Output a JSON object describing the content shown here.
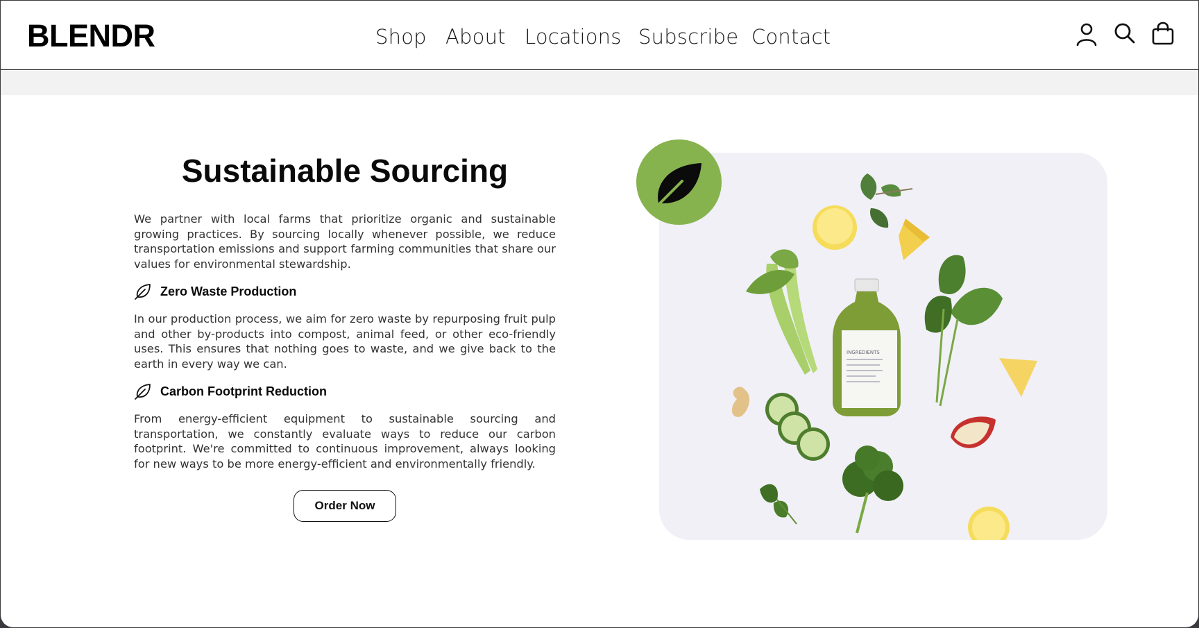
{
  "header": {
    "logo": "BLENDR",
    "nav": [
      {
        "label": "Shop"
      },
      {
        "label": "About"
      },
      {
        "label": "Locations"
      },
      {
        "label": "Subscribe"
      },
      {
        "label": "Contact"
      }
    ],
    "icons": [
      "user-icon",
      "search-icon",
      "shopping-bag-icon"
    ]
  },
  "main": {
    "title": "Sustainable Sourcing",
    "intro": "We partner with local farms that prioritize organic and sustainable growing practices. By sourcing locally whenever possible, we reduce transportation emissions and support farming communities that share our values for environmental stewardship.",
    "features": [
      {
        "icon": "leaf-icon",
        "title": "Zero Waste Production",
        "text": "In our production process, we aim for zero waste by repurposing fruit pulp and other by-products into compost, animal feed, or other eco-friendly uses. This ensures that nothing goes to waste, and we give back to the earth in every way we can."
      },
      {
        "icon": "leaf-icon",
        "title": "Carbon Footprint Reduction",
        "text": "From energy-efficient equipment to sustainable sourcing and transportation, we constantly evaluate ways to reduce our carbon footprint. We're committed to continuous improvement, always looking for new ways to be more energy-efficient and environmentally friendly."
      }
    ],
    "cta": "Order Now"
  },
  "image": {
    "badge_icon": "leaf-icon",
    "badge_color": "#87b34f",
    "bottle_label": "INGREDIENTS"
  },
  "colors": {
    "accent_green": "#87b34f",
    "text": "#0a0a0a",
    "body_text": "#333333",
    "strip": "#f2f2f2"
  }
}
